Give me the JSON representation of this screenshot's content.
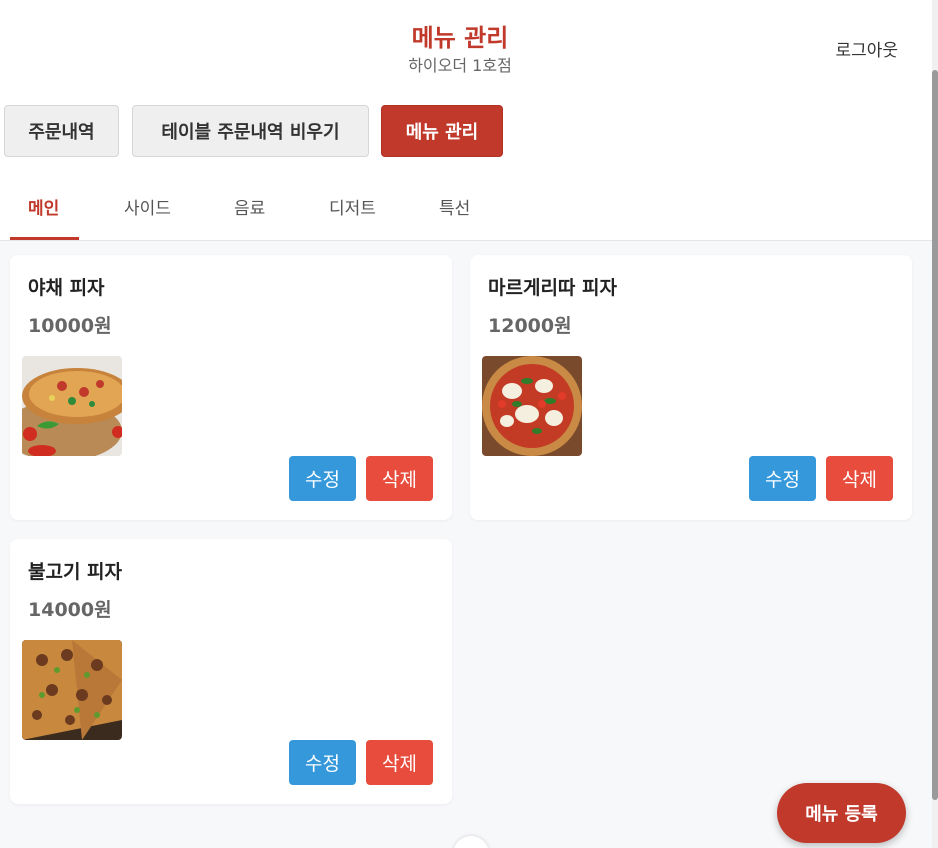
{
  "header": {
    "title": "메뉴 관리",
    "subtitle": "하이오더 1호점",
    "logout_label": "로그아웃"
  },
  "nav": {
    "orders_label": "주문내역",
    "clear_label": "테이블 주문내역 비우기",
    "menu_label": "메뉴 관리"
  },
  "tabs": [
    {
      "label": "메인",
      "active": true
    },
    {
      "label": "사이드",
      "active": false
    },
    {
      "label": "음료",
      "active": false
    },
    {
      "label": "디저트",
      "active": false
    },
    {
      "label": "특선",
      "active": false
    }
  ],
  "menu_items": [
    {
      "name": "야채 피자",
      "price": "10000원",
      "image": "vegetable-pizza-photo",
      "edit_label": "수정",
      "delete_label": "삭제"
    },
    {
      "name": "마르게리따 피자",
      "price": "12000원",
      "image": "margherita-pizza-photo",
      "edit_label": "수정",
      "delete_label": "삭제"
    },
    {
      "name": "불고기 피자",
      "price": "14000원",
      "image": "bulgogi-pizza-photo",
      "edit_label": "수정",
      "delete_label": "삭제"
    }
  ],
  "fab": {
    "label": "메뉴 등록"
  },
  "colors": {
    "accent": "#c0392b",
    "edit": "#3498db",
    "delete": "#e74c3c"
  }
}
